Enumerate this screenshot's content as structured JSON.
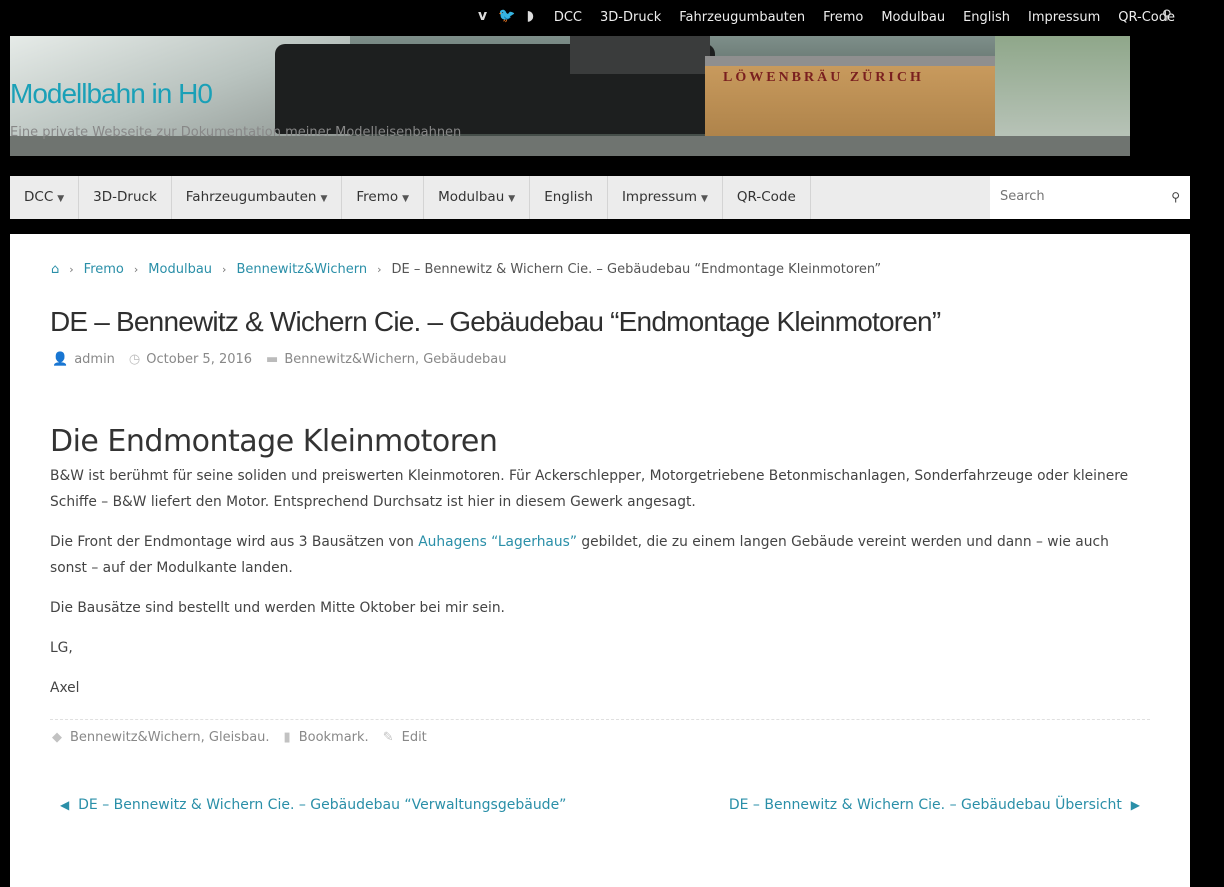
{
  "top": {
    "social": [
      {
        "icon": "vimeo-icon",
        "glyph": "v"
      },
      {
        "icon": "twitter-icon",
        "glyph": "🐦"
      },
      {
        "icon": "rss-icon",
        "glyph": "◗"
      }
    ],
    "menu": [
      "DCC",
      "3D-Druck",
      "Fahrzeugumbauten",
      "Fremo",
      "Modulbau",
      "English",
      "Impressum",
      "QR-Code"
    ],
    "search_glyph": "⚲"
  },
  "header": {
    "site_title": "Modellbahn in H0",
    "site_description": "Eine private Webseite zur Dokumentation meiner Modelleisenbahnen",
    "wagon_lettering": "LÖWENBRÄU ZÜRICH"
  },
  "nav": {
    "items": [
      {
        "label": "DCC",
        "dropdown": true
      },
      {
        "label": "3D-Druck",
        "dropdown": false
      },
      {
        "label": "Fahrzeugumbauten",
        "dropdown": true
      },
      {
        "label": "Fremo",
        "dropdown": true
      },
      {
        "label": "Modulbau",
        "dropdown": true
      },
      {
        "label": "English",
        "dropdown": false
      },
      {
        "label": "Impressum",
        "dropdown": true
      },
      {
        "label": "QR-Code",
        "dropdown": false
      }
    ],
    "search_placeholder": "Search"
  },
  "breadcrumb": {
    "home_glyph": "⌂",
    "items": [
      "Fremo",
      "Modulbau",
      "Bennewitz&Wichern"
    ],
    "current": "DE – Bennewitz & Wichern Cie. – Gebäudebau “Endmontage Kleinmotoren”"
  },
  "post": {
    "title": "DE – Bennewitz & Wichern Cie. – Gebäudebau “Endmontage Kleinmotoren”",
    "author": "admin",
    "date": "October 5, 2016",
    "categories": "Bennewitz&Wichern, Gebäudebau",
    "heading": "Die Endmontage Kleinmotoren",
    "p1": "B&W ist berühmt für seine soliden und preiswerten Kleinmotoren. Für Ackerschlepper, Motorgetriebene Betonmischanlagen, Sonderfahrzeuge oder kleinere Schiffe – B&W liefert den Motor. Entsprechend Durchsatz ist hier in diesem Gewerk angesagt.",
    "p2_before": "Die Front der Endmontage wird aus 3 Bausätzen von ",
    "p2_link": "Auhagens “Lagerhaus”",
    "p2_after": " gebildet, die zu einem langen Gebäude vereint werden und dann – wie auch sonst – auf der Modulkante landen.",
    "p3": "Die Bausätze sind bestellt und werden Mitte Oktober bei mir sein.",
    "p4": "LG,",
    "p5": "Axel",
    "tags": "Bennewitz&Wichern, Gleisbau.",
    "bookmark": "Bookmark.",
    "edit": "Edit"
  },
  "postnav": {
    "prev": "DE – Bennewitz & Wichern Cie. – Gebäudebau “Verwaltungsgebäude”",
    "next": "DE – Bennewitz & Wichern Cie. – Gebäudebau Übersicht"
  }
}
